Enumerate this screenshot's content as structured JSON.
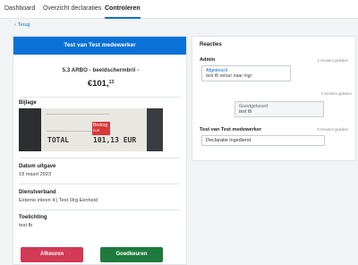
{
  "nav": {
    "tabs": [
      {
        "label": "Dashboard"
      },
      {
        "label": "Overzicht declaraties"
      },
      {
        "label": "Controleren"
      }
    ]
  },
  "back_label": "Terug",
  "card": {
    "header": "Test van Test medewerker",
    "item_name": "5.3 ARBO - beeldschermbril",
    "amount_main": "€101,",
    "amount_cents": "13",
    "attachment_label": "Bijlage",
    "receipt": {
      "total_label": "TOTAL",
      "total_value": "101,13 EUR",
      "tag_label": "Bedrag",
      "tag_sub": "EUR"
    },
    "date_label": "Datum uitgave",
    "date_value": "18 maart 2023",
    "employment_label": "Dienstverband",
    "employment_value": "Externe inleen 4 | Test Org.Eenheid",
    "note_label": "Toelichting",
    "note_value": "test fb",
    "reject_label": "Afkeuren",
    "approve_label": "Goedkeuren"
  },
  "reactions": {
    "title": "Reacties",
    "items": [
      {
        "author": "Admin",
        "time": "2 minuten geleden",
        "status": "Afgekeurd",
        "text": "test fb retour naar mgr"
      },
      {
        "author": "",
        "time": "3 minuten geleden",
        "status": "Goedgekeurd",
        "text": "test fb"
      },
      {
        "author": "Test van Test medewerker",
        "time": "6 minuten geleden",
        "status": "",
        "text": "Declaratie ingediend"
      }
    ]
  },
  "colors": {
    "accent": "#0a72d6",
    "reject": "#d23a55",
    "approve": "#1f7a3d"
  }
}
